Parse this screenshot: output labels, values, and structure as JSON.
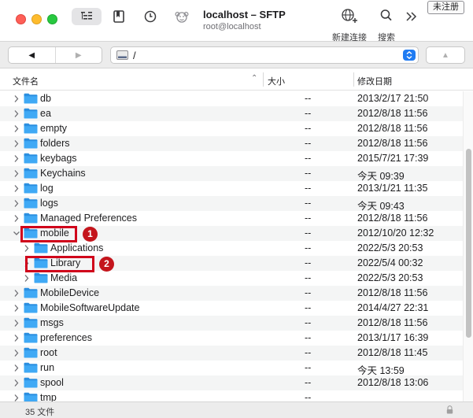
{
  "window": {
    "title": "localhost – SFTP",
    "subtitle": "root@localhost",
    "unregistered_label": "未注册"
  },
  "toolbar": {
    "outline_icon": "outline-view-icon",
    "bookmark_icon": "bookmark-icon",
    "history_icon": "history-clock-icon",
    "transfer_icon": "monkey-transfer-icon",
    "new_connection_label": "新建连接",
    "search_label": "搜索",
    "more_icon": "chevron-double-right-icon"
  },
  "navigation": {
    "back_icon": "◀",
    "forward_icon": "▶",
    "path": "/",
    "up_icon": "▲"
  },
  "columns": {
    "name": "文件名",
    "size": "大小",
    "modified": "修改日期"
  },
  "files": [
    {
      "name": "db",
      "size": "--",
      "date": "2013/2/17 21:50",
      "expanded": false,
      "depth": 0
    },
    {
      "name": "ea",
      "size": "--",
      "date": "2012/8/18 11:56",
      "expanded": false,
      "depth": 0
    },
    {
      "name": "empty",
      "size": "--",
      "date": "2012/8/18 11:56",
      "expanded": false,
      "depth": 0
    },
    {
      "name": "folders",
      "size": "--",
      "date": "2012/8/18 11:56",
      "expanded": false,
      "depth": 0
    },
    {
      "name": "keybags",
      "size": "--",
      "date": "2015/7/21 17:39",
      "expanded": false,
      "depth": 0
    },
    {
      "name": "Keychains",
      "size": "--",
      "date": "今天 09:39",
      "expanded": false,
      "depth": 0
    },
    {
      "name": "log",
      "size": "--",
      "date": "2013/1/21 11:35",
      "expanded": false,
      "depth": 0
    },
    {
      "name": "logs",
      "size": "--",
      "date": "今天 09:43",
      "expanded": false,
      "depth": 0
    },
    {
      "name": "Managed Preferences",
      "size": "--",
      "date": "2012/8/18 11:56",
      "expanded": false,
      "depth": 0
    },
    {
      "name": "mobile",
      "size": "--",
      "date": "2012/10/20 12:32",
      "expanded": true,
      "depth": 0
    },
    {
      "name": "Applications",
      "size": "--",
      "date": "2022/5/3 20:53",
      "expanded": false,
      "depth": 1
    },
    {
      "name": "Library",
      "size": "--",
      "date": "2022/5/4 00:32",
      "expanded": false,
      "depth": 1
    },
    {
      "name": "Media",
      "size": "--",
      "date": "2022/5/3 20:53",
      "expanded": false,
      "depth": 1
    },
    {
      "name": "MobileDevice",
      "size": "--",
      "date": "2012/8/18 11:56",
      "expanded": false,
      "depth": 0
    },
    {
      "name": "MobileSoftwareUpdate",
      "size": "--",
      "date": "2014/4/27 22:31",
      "expanded": false,
      "depth": 0
    },
    {
      "name": "msgs",
      "size": "--",
      "date": "2012/8/18 11:56",
      "expanded": false,
      "depth": 0
    },
    {
      "name": "preferences",
      "size": "--",
      "date": "2013/1/17 16:39",
      "expanded": false,
      "depth": 0
    },
    {
      "name": "root",
      "size": "--",
      "date": "2012/8/18 11:45",
      "expanded": false,
      "depth": 0
    },
    {
      "name": "run",
      "size": "--",
      "date": "今天 13:59",
      "expanded": false,
      "depth": 0
    },
    {
      "name": "spool",
      "size": "--",
      "date": "2012/8/18 13:06",
      "expanded": false,
      "depth": 0
    },
    {
      "name": "tmp",
      "size": "--",
      "date": "",
      "expanded": false,
      "depth": 0
    }
  ],
  "annotations": [
    {
      "label": "1",
      "target": "mobile"
    },
    {
      "label": "2",
      "target": "Library"
    }
  ],
  "status": {
    "item_count": "35 文件",
    "lock_icon": "lock-icon"
  },
  "colors": {
    "folder": "#3fa9f5",
    "annotation": "#d0021b",
    "accent": "#1f7bf2"
  }
}
